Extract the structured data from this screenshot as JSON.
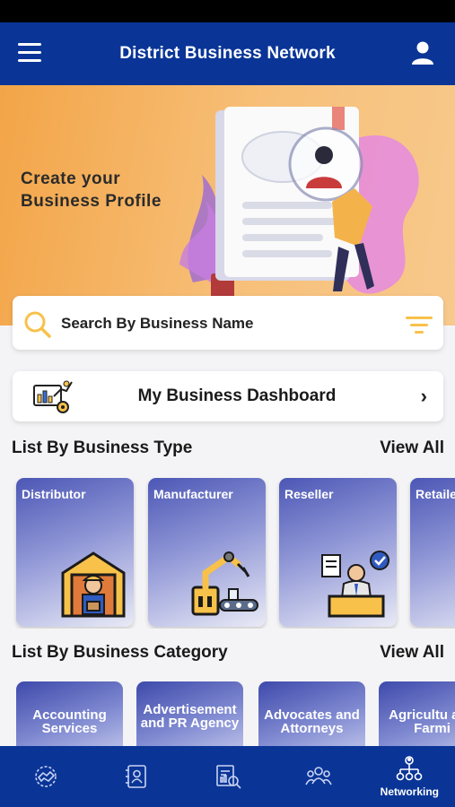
{
  "header": {
    "title": "District Business Network"
  },
  "banner": {
    "line1": "Create your",
    "line2": "Business Profile",
    "dot_count": 5,
    "active_dot": 0
  },
  "search": {
    "placeholder": "Search By Business Name"
  },
  "dashboard": {
    "label": "My Business Dashboard",
    "chevron": "›"
  },
  "business_type": {
    "heading": "List By Business Type",
    "view_all": "View All",
    "items": [
      {
        "label": "Distributor",
        "icon": "warehouse-worker-icon"
      },
      {
        "label": "Manufacturer",
        "icon": "robot-arm-icon"
      },
      {
        "label": "Reseller",
        "icon": "seller-icon"
      },
      {
        "label": "Retaile",
        "icon": "retailer-icon"
      }
    ]
  },
  "business_category": {
    "heading": "List By Business Category",
    "view_all": "View All",
    "items": [
      {
        "label": "Accounting Services"
      },
      {
        "label": "Advertisement and PR Agency"
      },
      {
        "label": "Advocates and Attorneys"
      },
      {
        "label": "Agricultu and Farmi"
      }
    ]
  },
  "bottom_nav": {
    "items": [
      {
        "icon": "handshake-icon",
        "label": ""
      },
      {
        "icon": "contacts-icon",
        "label": ""
      },
      {
        "icon": "report-search-icon",
        "label": ""
      },
      {
        "icon": "group-icon",
        "label": ""
      },
      {
        "icon": "network-icon",
        "label": "Networking"
      }
    ]
  },
  "colors": {
    "primary": "#0a3597",
    "accent": "#f7c14a",
    "banner": "#f3a548"
  }
}
